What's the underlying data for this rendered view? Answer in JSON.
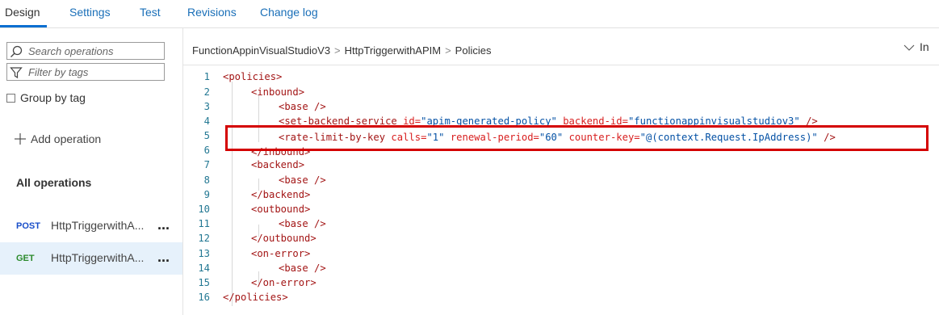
{
  "tabs": [
    "Design",
    "Settings",
    "Test",
    "Revisions",
    "Change log"
  ],
  "search": {
    "placeholder": "Search operations"
  },
  "filter": {
    "placeholder": "Filter by tags"
  },
  "group_by_tag_label": "Group by tag",
  "add_operation_label": "Add operation",
  "all_operations_label": "All operations",
  "operations": [
    {
      "method": "POST",
      "name": "HttpTriggerwithA...",
      "method_color": "#1a4fc9"
    },
    {
      "method": "GET",
      "name": "HttpTriggerwithA...",
      "method_color": "#2b8a2b"
    }
  ],
  "more_label": "...",
  "breadcrumb": {
    "api": "FunctionAppinVisualStudioV3",
    "operation": "HttpTriggerwithAPIM",
    "section": "Policies",
    "separator": ">"
  },
  "toggle_label": "In",
  "code_lines": [
    {
      "n": "1",
      "tag": "<policies>"
    },
    {
      "n": "2",
      "tag": "<inbound>"
    },
    {
      "n": "3",
      "tag": "<base />"
    },
    {
      "n": "4",
      "tag": "<set-backend-service",
      "a1": "id=",
      "v1": "\"apim-generated-policy\"",
      "a2": "backend-id=",
      "v2": "\"functionappinvisualstudiov3\"",
      "end": "/>"
    },
    {
      "n": "5",
      "tag": "<rate-limit-by-key",
      "a1": "calls=",
      "v1": "\"1\"",
      "a2": "renewal-period=",
      "v2": "\"60\"",
      "a3": "counter-key=",
      "v3": "\"@(context.Request.IpAddress)\"",
      "end": "/>"
    },
    {
      "n": "6",
      "tag": "</inbound>"
    },
    {
      "n": "7",
      "tag": "<backend>"
    },
    {
      "n": "8",
      "tag": "<base />"
    },
    {
      "n": "9",
      "tag": "</backend>"
    },
    {
      "n": "10",
      "tag": "<outbound>"
    },
    {
      "n": "11",
      "tag": "<base />"
    },
    {
      "n": "12",
      "tag": "</outbound>"
    },
    {
      "n": "13",
      "tag": "<on-error>"
    },
    {
      "n": "14",
      "tag": "<base />"
    },
    {
      "n": "15",
      "tag": "</on-error>"
    },
    {
      "n": "16",
      "tag": "</policies>"
    }
  ],
  "colors": {
    "accent": "#0a6fd1",
    "highlight_border": "#d40000",
    "selected_row": "#e6f1fb",
    "xml_tag": "#a31515",
    "xml_value": "#0451a5"
  }
}
